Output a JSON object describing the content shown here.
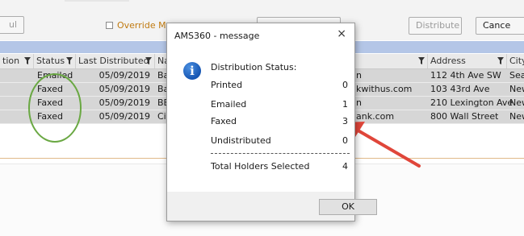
{
  "toolbar": {
    "left_button_label": "ul",
    "override_label": "Override Me",
    "distribute_label": "Distribute",
    "cancel_label": "Cance"
  },
  "grid": {
    "headers": [
      "tion",
      "Status",
      "Last Distributed",
      "Na",
      "",
      "Address",
      "City"
    ],
    "rows": [
      {
        "status": "Emailed",
        "date": "05/09/2019",
        "name": "Ba",
        "contact": "n",
        "address": "112 4th Ave SW",
        "city": "Sea"
      },
      {
        "status": "Faxed",
        "date": "05/09/2019",
        "name": "Ba",
        "contact": "kwithus.com",
        "address": "103 43rd Ave",
        "city": "New"
      },
      {
        "status": "Faxed",
        "date": "05/09/2019",
        "name": "BE",
        "contact": "n",
        "address": "210 Lexington Ave",
        "city": "New"
      },
      {
        "status": "Faxed",
        "date": "05/09/2019",
        "name": "Ci",
        "contact": "ank.com",
        "address": "800 Wall Street",
        "city": "New"
      }
    ]
  },
  "dialog": {
    "title": "AMS360 - message",
    "close_glyph": "×",
    "heading": "Distribution Status:",
    "lines": [
      {
        "label": "Printed",
        "value": "0"
      },
      {
        "label": "Emailed",
        "value": "1"
      },
      {
        "label": "Faxed",
        "value": "3"
      },
      {
        "label": "Undistributed",
        "value": "0"
      }
    ],
    "total": {
      "label": "Total Holders Selected",
      "value": "4"
    },
    "ok_label": "OK",
    "icon": "info-icon"
  },
  "annotations": {
    "circle_color": "#6aa843",
    "arrow_color": "#e0463a"
  }
}
